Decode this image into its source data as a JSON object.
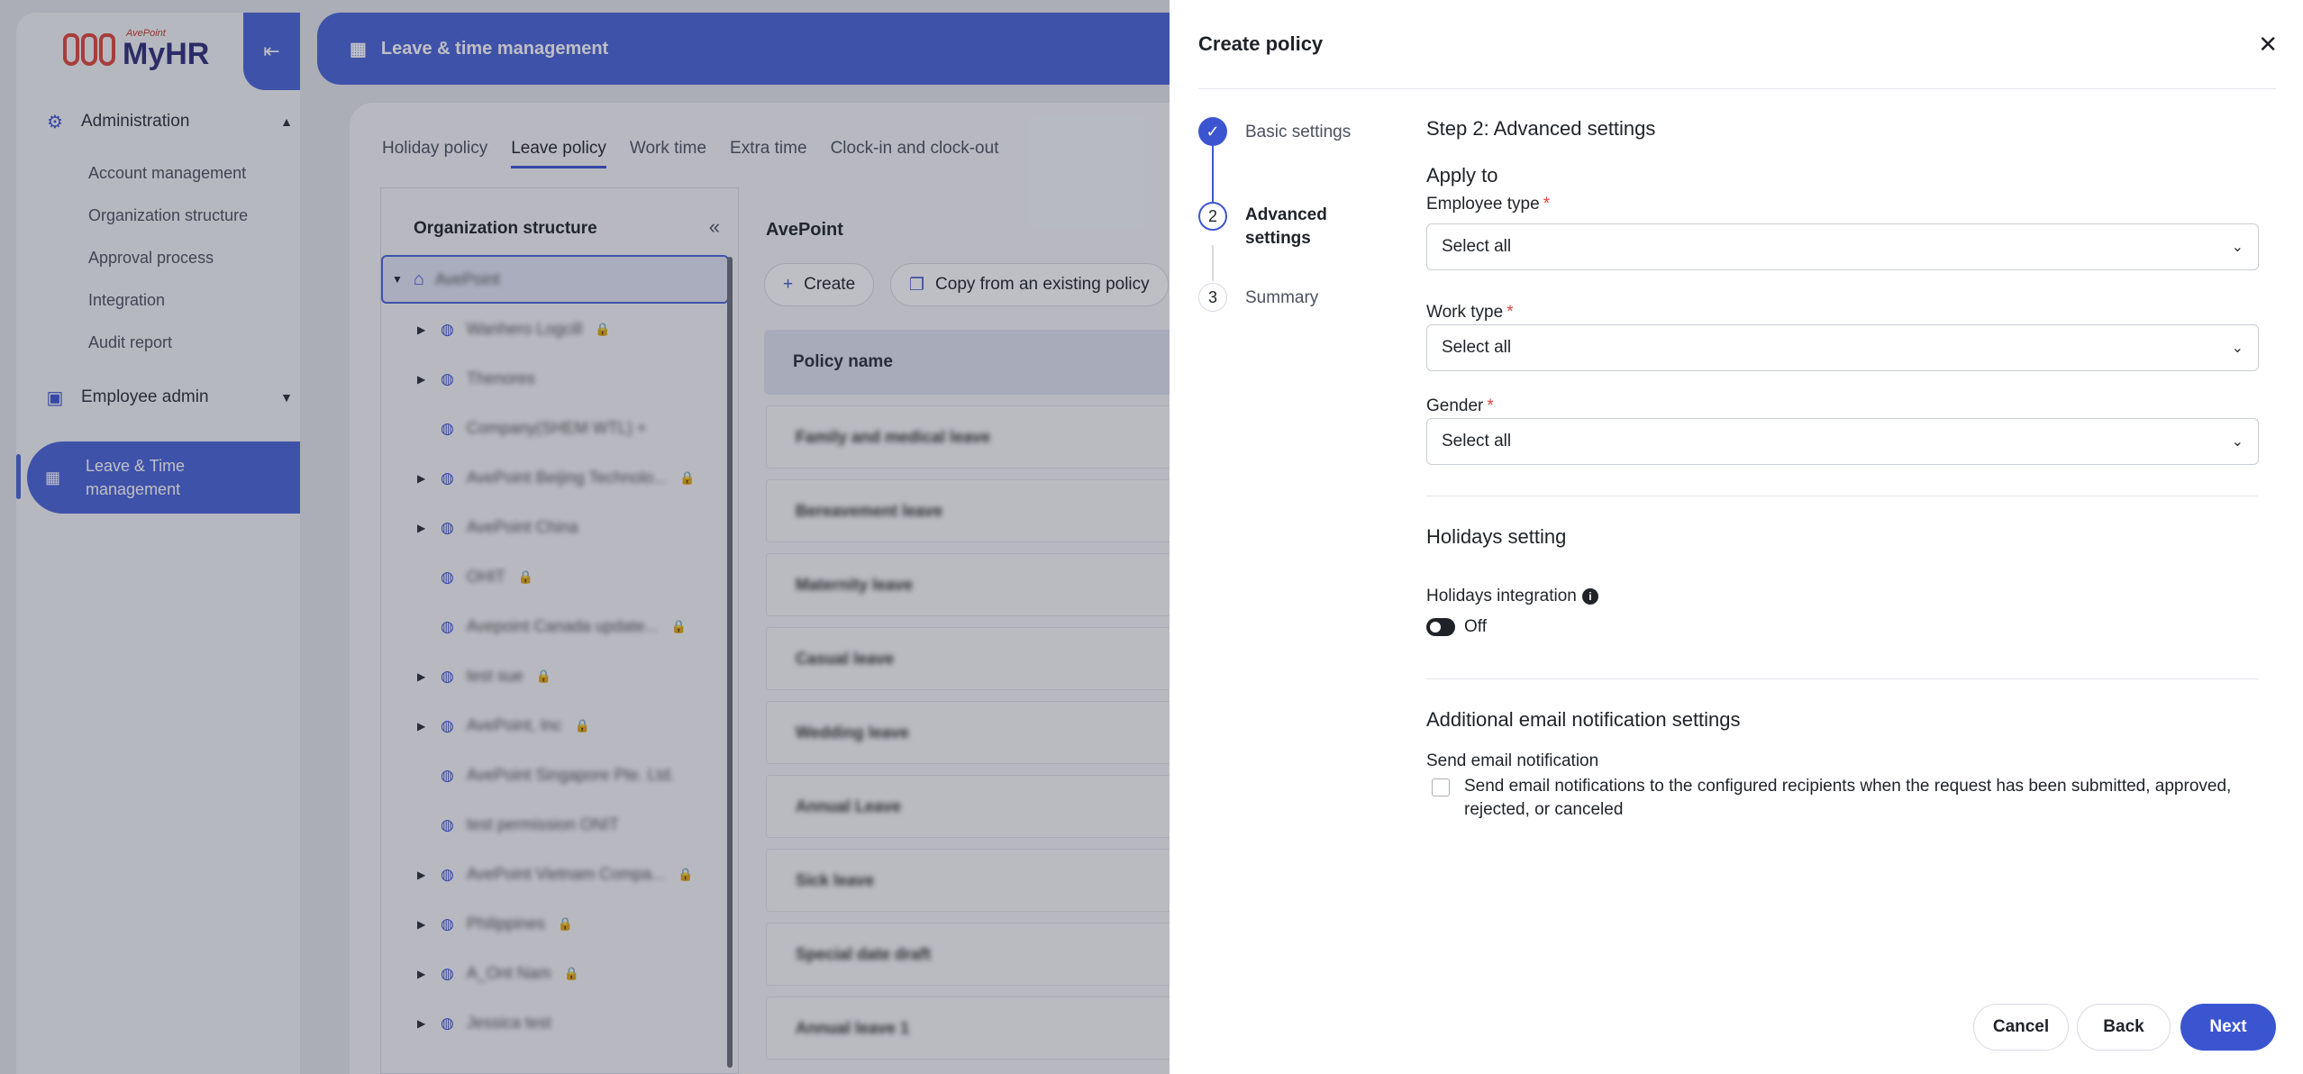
{
  "app": {
    "logo_small": "AvePoint",
    "logo_main": "MyHR"
  },
  "sidebar": {
    "groups": [
      {
        "label": "Administration",
        "icon": "gear-icon"
      },
      {
        "label": "Employee admin",
        "icon": "badge-icon"
      }
    ],
    "admin_items": [
      "Account management",
      "Organization structure",
      "Approval process",
      "Integration",
      "Audit report"
    ],
    "active_item": {
      "label": "Leave & Time management",
      "icon": "calendar-icon"
    }
  },
  "header": {
    "title": "Leave & time management",
    "icon": "calendar-icon"
  },
  "tabs": [
    "Holiday policy",
    "Leave policy",
    "Work time",
    "Extra time",
    "Clock-in and clock-out"
  ],
  "active_tab": "Leave policy",
  "org_panel": {
    "title": "Organization structure",
    "root": "AvePoint",
    "items": [
      {
        "label": "Wanhero Logcill",
        "arrow": true,
        "lock": true
      },
      {
        "label": "Thenores",
        "arrow": true,
        "lock": false
      },
      {
        "label": "Company(SHEM WTL) +",
        "arrow": false,
        "lock": false
      },
      {
        "label": "AvePoint Beijing Technolo...",
        "arrow": true,
        "lock": true
      },
      {
        "label": "AvePoint China",
        "arrow": true,
        "lock": false
      },
      {
        "label": "OHIT",
        "arrow": false,
        "lock": true
      },
      {
        "label": "Avepoint Canada update...",
        "arrow": false,
        "lock": true
      },
      {
        "label": "test sue",
        "arrow": true,
        "lock": true
      },
      {
        "label": "AvePoint, Inc",
        "arrow": true,
        "lock": true
      },
      {
        "label": "AvePoint Singapore Pte. Ltd.",
        "arrow": false,
        "lock": false
      },
      {
        "label": "test permission ONIT",
        "arrow": false,
        "lock": false
      },
      {
        "label": "AvePoint Vietnam Compa...",
        "arrow": true,
        "lock": true
      },
      {
        "label": "Philippines",
        "arrow": true,
        "lock": true
      },
      {
        "label": "A_Ont Nam",
        "arrow": true,
        "lock": true
      },
      {
        "label": "Jessica test",
        "arrow": true,
        "lock": false
      }
    ]
  },
  "policy_list": {
    "company": "AvePoint",
    "create_label": "Create",
    "copy_label": "Copy from an existing policy",
    "column_header": "Policy name",
    "rows": [
      "Family and medical leave",
      "Bereavement leave",
      "Maternity leave",
      "Casual leave",
      "Wedding leave",
      "Annual Leave",
      "Sick leave",
      "Special date draft",
      "Annual leave 1"
    ]
  },
  "dialog": {
    "title": "Create policy",
    "steps": [
      {
        "num": "1",
        "label": "Basic settings",
        "state": "done"
      },
      {
        "num": "2",
        "label": "Advanced settings",
        "state": "current"
      },
      {
        "num": "3",
        "label": "Summary",
        "state": "todo"
      }
    ],
    "step_heading": "Step 2: Advanced settings",
    "apply_to": {
      "heading": "Apply to",
      "employee_type": {
        "label": "Employee type",
        "required": "*",
        "value": "Select all"
      },
      "work_type": {
        "label": "Work type",
        "required": "*",
        "value": "Select all"
      },
      "gender": {
        "label": "Gender",
        "required": "*",
        "value": "Select all"
      }
    },
    "holidays": {
      "heading": "Holidays setting",
      "integration_label": "Holidays integration",
      "toggle_state": "Off"
    },
    "email": {
      "heading": "Additional email notification settings",
      "send_label": "Send email notification",
      "checkbox_text": "Send email notifications to the configured recipients when the request has been submitted, approved, rejected, or canceled",
      "checked": false
    },
    "buttons": {
      "cancel": "Cancel",
      "back": "Back",
      "next": "Next"
    }
  }
}
